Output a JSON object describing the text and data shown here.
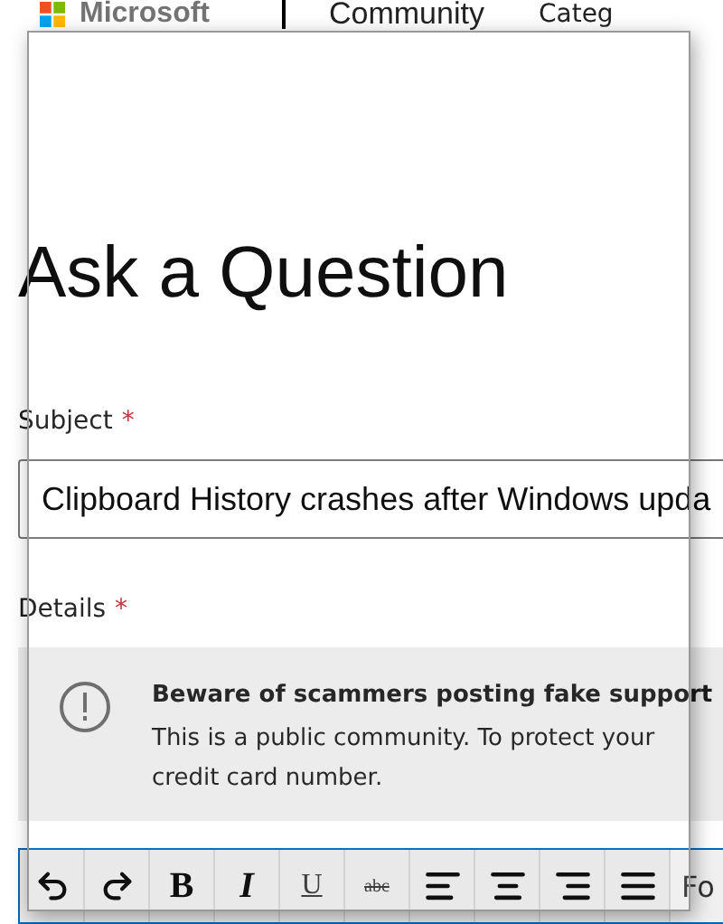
{
  "header": {
    "brand": "Microsoft",
    "site": "Community",
    "nav_item": "Categ"
  },
  "title": "Ask a Question",
  "subject": {
    "label": "Subject",
    "required_mark": "*",
    "value": "Clipboard History crashes after Windows upda"
  },
  "details": {
    "label": "Details",
    "required_mark": "*"
  },
  "notice": {
    "heading": "Beware of scammers posting fake support",
    "body_line_1": "This is a public community. To protect your",
    "body_line_2": "credit card number."
  },
  "toolbar": {
    "format_buttons": [
      {
        "kind": "bold",
        "label": "B"
      },
      {
        "kind": "italic",
        "label": "I"
      },
      {
        "kind": "underline",
        "label": "U"
      },
      {
        "kind": "strikethrough",
        "label": "abc"
      }
    ],
    "font_menu": "Fo"
  }
}
